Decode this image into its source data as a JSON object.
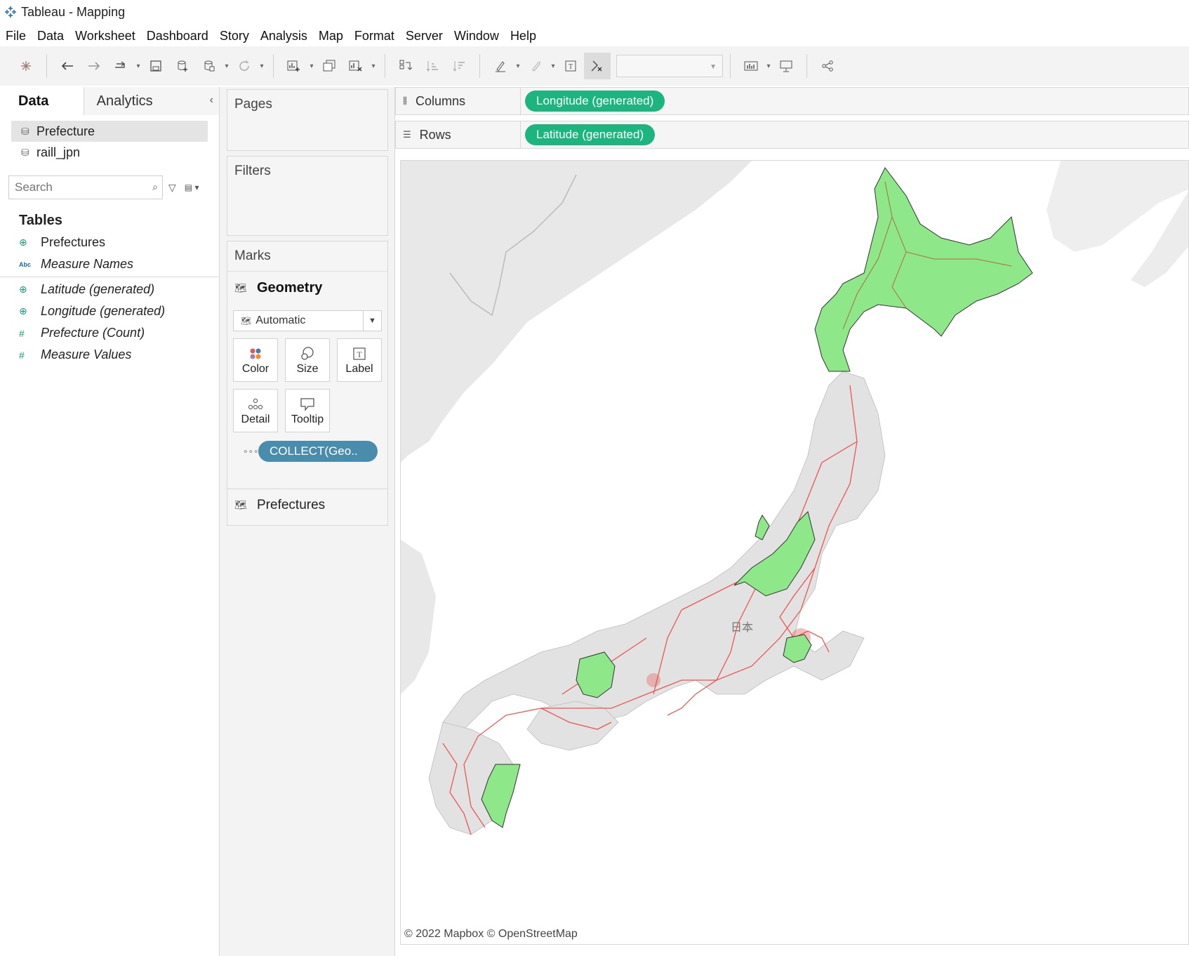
{
  "window": {
    "title": "Tableau - Mapping"
  },
  "menu": [
    "File",
    "Data",
    "Worksheet",
    "Dashboard",
    "Story",
    "Analysis",
    "Map",
    "Format",
    "Server",
    "Window",
    "Help"
  ],
  "left_pane": {
    "tabs": {
      "data": "Data",
      "analytics": "Analytics"
    },
    "datasources": [
      {
        "label": "Prefecture",
        "icon": "database-icon",
        "selected": true
      },
      {
        "label": "raill_jpn",
        "icon": "database-link-icon",
        "selected": false
      }
    ],
    "search": {
      "placeholder": "Search"
    },
    "tables_header": "Tables",
    "fields": [
      {
        "label": "Prefectures",
        "icon": "geo-icon",
        "italic": false
      },
      {
        "label": "Measure Names",
        "icon": "abc-icon",
        "italic": true
      },
      {
        "label": "Latitude (generated)",
        "icon": "geo-icon",
        "italic": true
      },
      {
        "label": "Longitude (generated)",
        "icon": "geo-icon",
        "italic": true
      },
      {
        "label": "Prefecture (Count)",
        "icon": "number-icon",
        "italic": true
      },
      {
        "label": "Measure Values",
        "icon": "number-icon",
        "italic": true
      }
    ]
  },
  "cards": {
    "pages": "Pages",
    "filters": "Filters",
    "marks": {
      "title": "Marks",
      "layer": "Geometry",
      "mark_type": "Automatic",
      "buttons": {
        "color": "Color",
        "size": "Size",
        "label": "Label",
        "detail": "Detail",
        "tooltip": "Tooltip"
      },
      "pill": "COLLECT(Geo..",
      "second_layer": "Prefectures"
    }
  },
  "shelves": {
    "columns": {
      "label": "Columns",
      "pill": "Longitude (generated)"
    },
    "rows": {
      "label": "Rows",
      "pill": "Latitude (generated)"
    }
  },
  "map": {
    "place_label": "日本",
    "attribution": "© 2022 Mapbox © OpenStreetMap",
    "colors": {
      "highlight": "#8ee88a",
      "land": "#e5e5e5",
      "rail": "#e8403c",
      "water": "#ffffff"
    }
  }
}
